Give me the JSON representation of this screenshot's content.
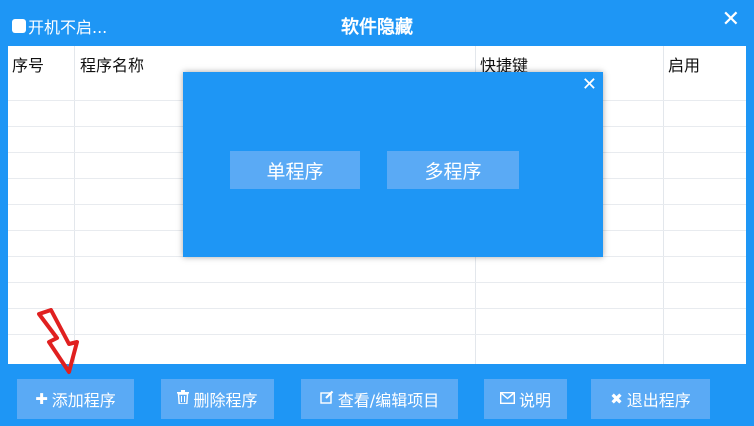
{
  "window": {
    "title": "软件隐藏",
    "autostart_label": "开机不启...",
    "close_icon": "close-icon"
  },
  "table": {
    "columns": [
      "序号",
      "程序名称",
      "快捷键",
      "启用"
    ]
  },
  "dialog": {
    "buttons": [
      "单程序",
      "多程序"
    ],
    "close_icon": "close-icon"
  },
  "toolbar": {
    "add_label": "添加程序",
    "delete_label": "删除程序",
    "edit_label": "查看/编辑项目",
    "help_label": "说明",
    "exit_label": "退出程序"
  },
  "colors": {
    "primary": "#1e96f5",
    "button": "#5aaaf5",
    "arrow": "#e02020"
  }
}
